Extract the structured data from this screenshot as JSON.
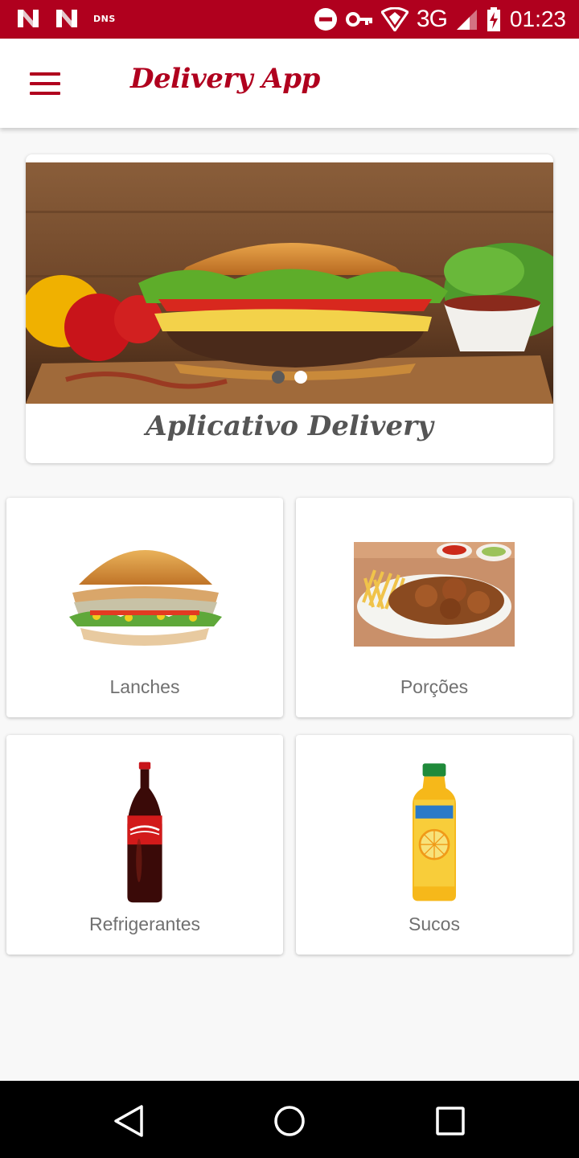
{
  "status_bar": {
    "notification_icons": [
      "n-logo-icon",
      "n-logo-icon"
    ],
    "dns_label": "DNS",
    "network_label": "3G",
    "time": "01:23"
  },
  "app_bar": {
    "title": "Delivery App",
    "menu_icon": "hamburger-menu-icon"
  },
  "banner": {
    "image": "burger-banner-image",
    "caption": "Aplicativo Delivery",
    "slides": 2,
    "active_slide": 1
  },
  "categories": [
    {
      "label": "Lanches",
      "image": "sandwich-image"
    },
    {
      "label": "Porções",
      "image": "fries-and-chicken-image"
    },
    {
      "label": "Refrigerantes",
      "image": "soda-bottle-image"
    },
    {
      "label": "Sucos",
      "image": "juice-bottle-image"
    }
  ],
  "nav_bar": {
    "back": "back-triangle-icon",
    "home": "home-circle-icon",
    "recents": "recents-square-icon"
  },
  "colors": {
    "primary": "#b0001e",
    "background": "#f8f8f8",
    "label_text": "#707070"
  }
}
